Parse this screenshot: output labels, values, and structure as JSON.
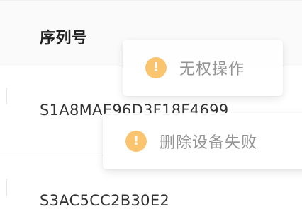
{
  "table": {
    "columns": [
      "序列号"
    ],
    "rows": [
      {
        "serial": "S1A8MAE96D3F18F4699"
      },
      {
        "serial": "S3AC5CC2B30E2"
      }
    ]
  },
  "toasts": [
    {
      "type": "warning",
      "icon": "warning-icon",
      "glyph": "!",
      "message": "无权操作"
    },
    {
      "type": "warning",
      "icon": "warning-icon",
      "glyph": "!",
      "message": "删除设备失败"
    }
  ],
  "colors": {
    "warning": "#fbbf63",
    "toast_text": "#8c8c8c",
    "header_bg": "#fafafa"
  }
}
